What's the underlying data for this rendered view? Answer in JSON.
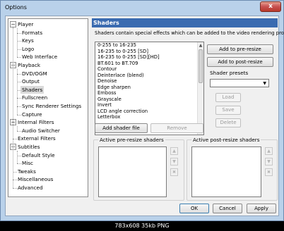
{
  "window": {
    "title": "Options",
    "close_glyph": "x"
  },
  "tree": [
    {
      "label": "Player",
      "level": 0,
      "expander": "−"
    },
    {
      "label": "Formats",
      "level": 1
    },
    {
      "label": "Keys",
      "level": 1
    },
    {
      "label": "Logo",
      "level": 1
    },
    {
      "label": "Web Interface",
      "level": 1
    },
    {
      "label": "Playback",
      "level": 0,
      "expander": "−"
    },
    {
      "label": "DVD/OGM",
      "level": 1
    },
    {
      "label": "Output",
      "level": 1
    },
    {
      "label": "Shaders",
      "level": 1,
      "selected": true
    },
    {
      "label": "Fullscreen",
      "level": 1
    },
    {
      "label": "Sync Renderer Settings",
      "level": 1
    },
    {
      "label": "Capture",
      "level": 1
    },
    {
      "label": "Internal Filters",
      "level": 0,
      "expander": "−"
    },
    {
      "label": "Audio Switcher",
      "level": 1
    },
    {
      "label": "External Filters",
      "level": 0
    },
    {
      "label": "Subtitles",
      "level": 0,
      "expander": "−"
    },
    {
      "label": "Default Style",
      "level": 1
    },
    {
      "label": "Misc",
      "level": 1
    },
    {
      "label": "Tweaks",
      "level": 0
    },
    {
      "label": "Miscellaneous",
      "level": 0
    },
    {
      "label": "Advanced",
      "level": 0
    }
  ],
  "panel": {
    "title": "Shaders",
    "description": "Shaders contain special effects which can be added to the video rendering process."
  },
  "shaders": [
    "0-255 to 16-235",
    "16-235 to 0-255 [SD]",
    "16-235 to 0-255 [SD][HD]",
    "BT.601 to BT.709",
    "Contour",
    "Deinterlace (blend)",
    "Denoise",
    "Edge sharpen",
    "Emboss",
    "Grayscale",
    "Invert",
    "LCD angle correction",
    "Letterbox"
  ],
  "buttons": {
    "add_pre_resize": "Add to pre-resize",
    "add_post_resize": "Add to post-resize",
    "add_shader_file": "Add shader file",
    "remove": "Remove",
    "load": "Load",
    "save": "Save",
    "delete": "Delete",
    "ok": "OK",
    "cancel": "Cancel",
    "apply": "Apply"
  },
  "presets": {
    "label": "Shader presets",
    "value": ""
  },
  "groups": {
    "pre_resize": "Active pre-resize shaders",
    "post_resize": "Active post-resize shaders"
  },
  "mini_buttons": {
    "up": "▲",
    "down": "▼",
    "remove": "✖"
  },
  "caption": "783x608 35kb PNG"
}
